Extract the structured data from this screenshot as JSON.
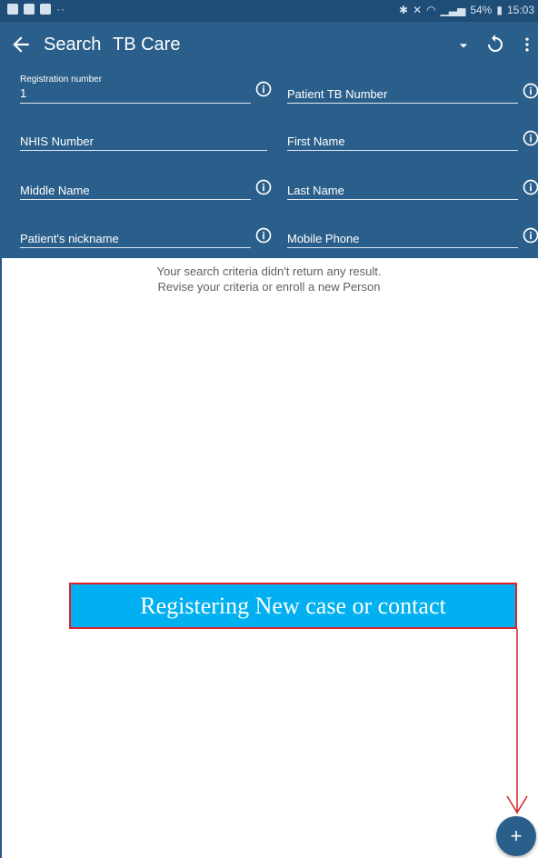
{
  "status_bar": {
    "left_icons": [
      "facebook-icon",
      "youtube-icon",
      "gallery-icon"
    ],
    "left_more": "··",
    "right_text": "54%",
    "time": "15:03",
    "right_icons": [
      "bluetooth-icon",
      "mute-icon",
      "wifi-icon",
      "signal-icon",
      "battery-icon"
    ]
  },
  "toolbar": {
    "search_label": "Search",
    "program_label": "TB Care"
  },
  "fields": {
    "registration_number": {
      "label": "Registration number",
      "value": "1"
    },
    "patient_tb_number": {
      "placeholder": "Patient TB Number"
    },
    "nhis_number": {
      "placeholder": "NHIS Number"
    },
    "first_name": {
      "placeholder": "First Name"
    },
    "middle_name": {
      "placeholder": "Middle Name"
    },
    "last_name": {
      "placeholder": "Last Name"
    },
    "nickname": {
      "placeholder": "Patient's nickname"
    },
    "mobile_phone": {
      "placeholder": "Mobile Phone"
    }
  },
  "empty_state": {
    "line1": "Your search criteria didn't return any result.",
    "line2": "Revise your criteria or enroll a new Person"
  },
  "callout": {
    "text": "Registering New case or contact",
    "fill_color": "#00b0f0",
    "border_color": "#e0202a"
  },
  "fab": {
    "label": "+"
  },
  "colors": {
    "header": "#2b5f8b",
    "status_bar": "#1e4d78",
    "arrow": "#d0232b"
  }
}
